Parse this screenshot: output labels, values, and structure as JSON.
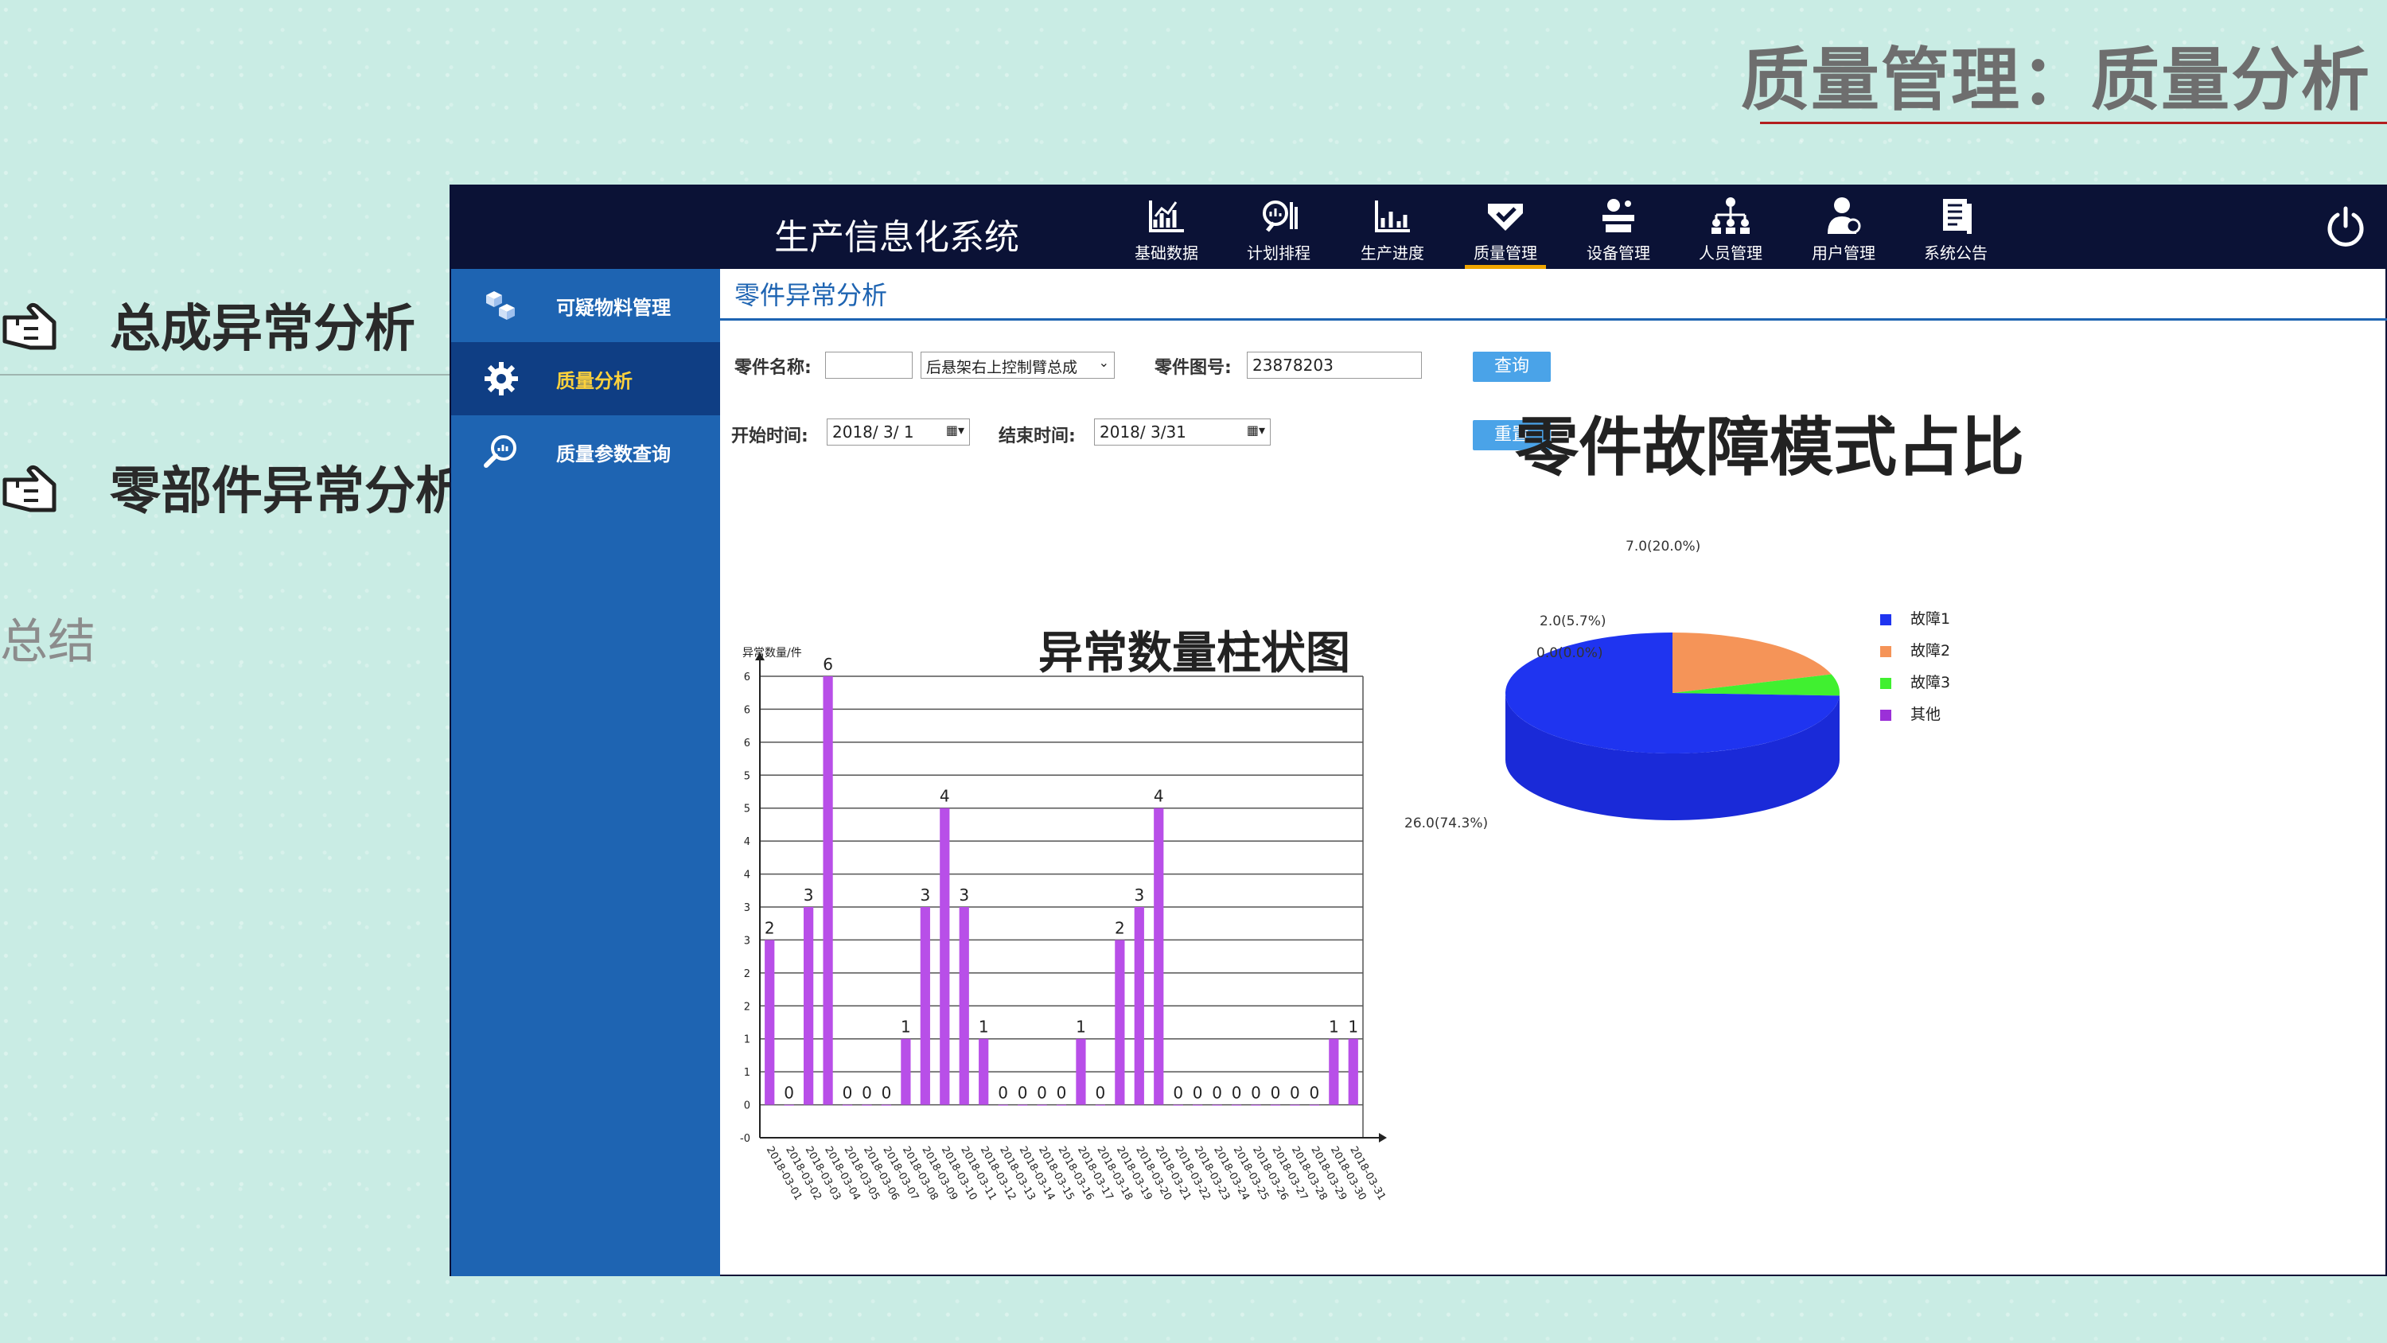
{
  "slide": {
    "title": "质量管理：质量分析",
    "outline": [
      "总成异常分析",
      "零部件异常分析",
      "总结"
    ]
  },
  "app": {
    "system_title": "生产信息化系统",
    "nav": [
      {
        "label": "基础数据",
        "icon": "chart-icon"
      },
      {
        "label": "计划排程",
        "icon": "search-chart-icon"
      },
      {
        "label": "生产进度",
        "icon": "progress-chart-icon"
      },
      {
        "label": "质量管理",
        "icon": "quality-icon",
        "active": true
      },
      {
        "label": "设备管理",
        "icon": "equipment-icon"
      },
      {
        "label": "人员管理",
        "icon": "org-icon"
      },
      {
        "label": "用户管理",
        "icon": "user-icon"
      },
      {
        "label": "系统公告",
        "icon": "notice-icon"
      }
    ],
    "sidebar": [
      {
        "label": "可疑物料管理",
        "icon": "cubes-icon"
      },
      {
        "label": "质量分析",
        "icon": "gear-icon",
        "active": true
      },
      {
        "label": "质量参数查询",
        "icon": "search-icon"
      }
    ],
    "panel_title": "零件异常分析",
    "form": {
      "part_name_label": "零件名称:",
      "part_name_value": "",
      "part_select_value": "后悬架右上控制臂总成",
      "part_no_label": "零件图号:",
      "part_no_value": "23878203",
      "query_button": "查询",
      "start_label": "开始时间:",
      "start_value": "2018/ 3/ 1",
      "end_label": "结束时间:",
      "end_value": "2018/ 3/31",
      "reset_button": "重置"
    },
    "bar_title": "异常数量柱状图",
    "pie_title": "零件故障模式占比"
  },
  "colors": {
    "navy": "#0b1236",
    "sidebar": "#1e64b2",
    "bar": "#b84fe8",
    "pie_fault1": "#1f34f0",
    "pie_fault2": "#f59458",
    "pie_fault3": "#40f030",
    "pie_other": "#9b30d8"
  },
  "chart_data": [
    {
      "type": "bar",
      "title": "异常数量柱状图",
      "ylabel": "异常数量/件",
      "ylim": [
        -0.5,
        6.5
      ],
      "yticks": [
        -0.5,
        0,
        0.5,
        1,
        1.5,
        2,
        2.5,
        3,
        3.5,
        4,
        4.5,
        5,
        5.5,
        6,
        6.5
      ],
      "ytick_labels": [
        "-0",
        "0",
        "1",
        "1",
        "2",
        "2",
        "3",
        "3",
        "4",
        "4",
        "5",
        "5",
        "6",
        "6",
        "6"
      ],
      "grid": true,
      "categories": [
        "2018-03-01",
        "2018-03-02",
        "2018-03-03",
        "2018-03-04",
        "2018-03-05",
        "2018-03-06",
        "2018-03-07",
        "2018-03-08",
        "2018-03-09",
        "2018-03-10",
        "2018-03-11",
        "2018-03-12",
        "2018-03-13",
        "2018-03-14",
        "2018-03-15",
        "2018-03-16",
        "2018-03-17",
        "2018-03-18",
        "2018-03-19",
        "2018-03-20",
        "2018-03-21",
        "2018-03-22",
        "2018-03-23",
        "2018-03-24",
        "2018-03-25",
        "2018-03-26",
        "2018-03-27",
        "2018-03-28",
        "2018-03-29",
        "2018-03-30",
        "2018-03-31"
      ],
      "values": [
        2.5,
        0,
        3,
        6.5,
        0,
        0,
        0,
        1,
        3,
        4.5,
        3,
        1,
        0,
        0,
        0,
        0,
        1,
        0,
        2.5,
        3,
        4.5,
        0,
        0,
        0,
        0,
        0,
        0,
        0,
        0,
        1,
        1
      ],
      "data_labels": [
        "2",
        "0",
        "3",
        "6",
        "0",
        "0",
        "0",
        "1",
        "3",
        "4",
        "3",
        "1",
        "0",
        "0",
        "0",
        "0",
        "1",
        "0",
        "2",
        "3",
        "4",
        "0",
        "0",
        "0",
        "0",
        "0",
        "0",
        "0",
        "0",
        "1",
        "1"
      ]
    },
    {
      "type": "pie",
      "title": "零件故障模式占比",
      "slices": [
        {
          "name": "故障1",
          "value": 26.0,
          "label": "26.0(74.3%)"
        },
        {
          "name": "故障2",
          "value": 7.0,
          "label": "7.0(20.0%)"
        },
        {
          "name": "故障3",
          "value": 2.0,
          "label": "2.0(5.7%)"
        },
        {
          "name": "其他",
          "value": 0.0,
          "label": "0.0(0.0%)"
        }
      ],
      "legend": "right"
    }
  ]
}
